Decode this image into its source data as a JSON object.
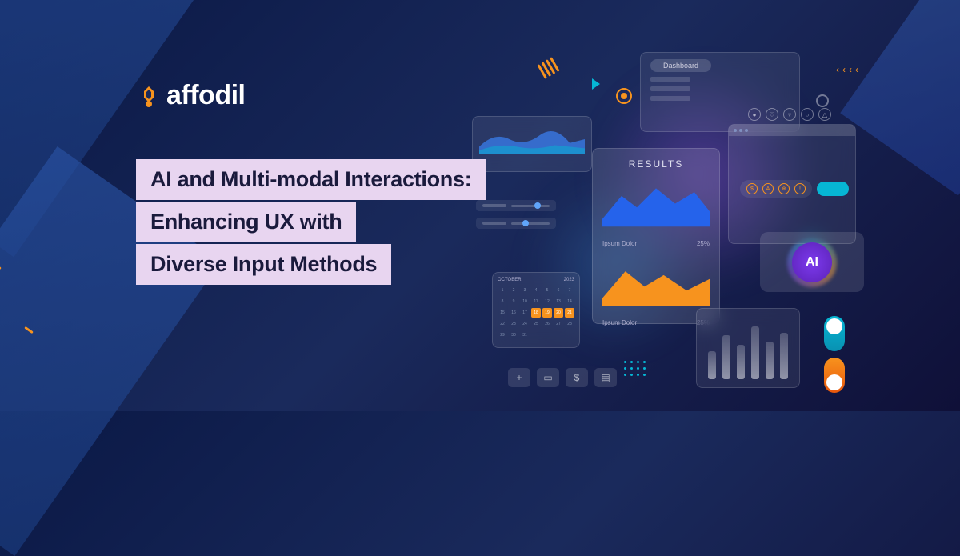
{
  "logo": {
    "text": "affodil"
  },
  "headline": {
    "line1": "AI and Multi-modal Interactions:",
    "line2": "Enhancing UX with",
    "line3": "Diverse Input Methods"
  },
  "dashboard": {
    "label": "Dashboard"
  },
  "results": {
    "title": "RESULTS",
    "row1_label": "Ipsum Dolor",
    "row1_value": "25%",
    "row2_label": "Ipsum Dolor",
    "row2_value": "25%"
  },
  "calendar": {
    "month": "OCTOBER",
    "year": "2023"
  },
  "ai_badge": {
    "text": "AI"
  }
}
